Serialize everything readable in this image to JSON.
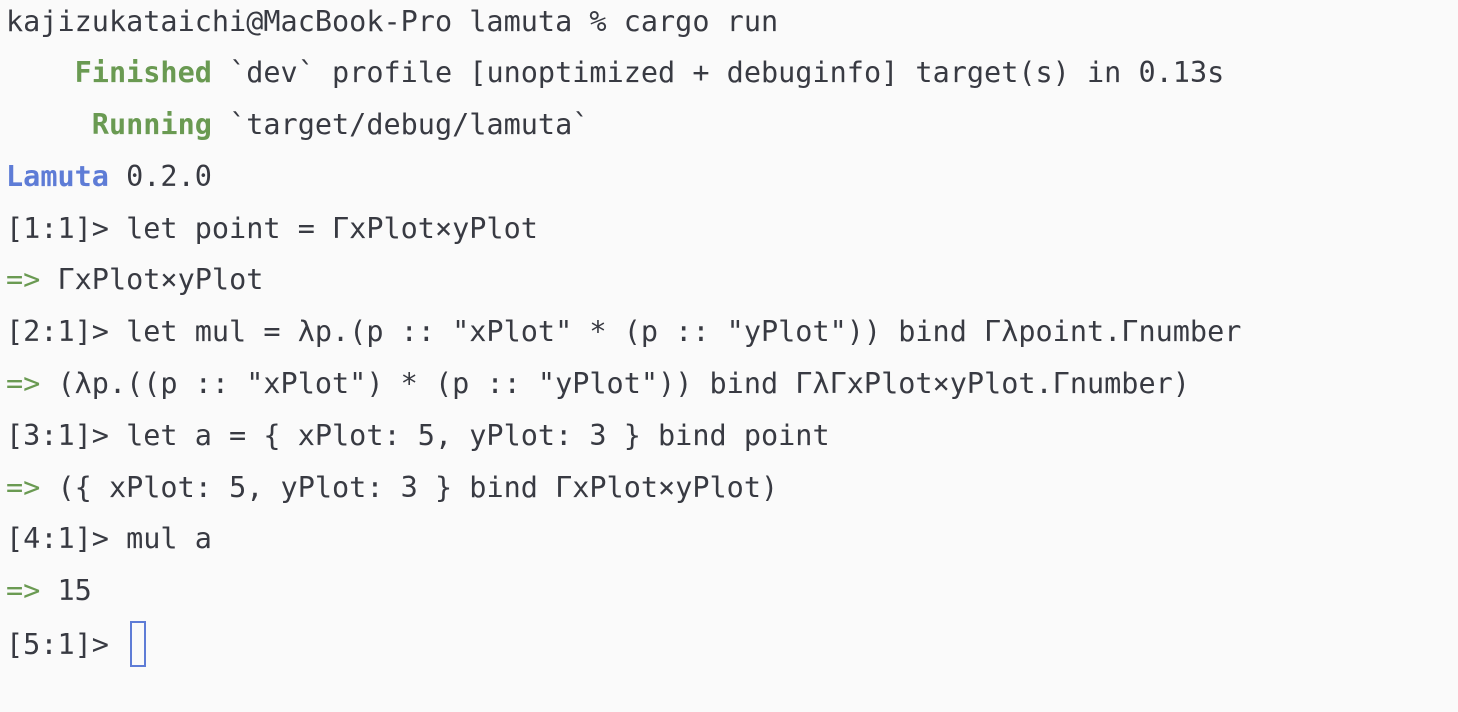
{
  "terminal": {
    "prompt_line": "kajizukataichi@MacBook-Pro lamuta % cargo run",
    "finished": {
      "indent": "    ",
      "label": "Finished",
      "text": " `dev` profile [unoptimized + debuginfo] target(s) in 0.13s"
    },
    "running": {
      "indent": "     ",
      "label": "Running",
      "text": " `target/debug/lamuta`"
    },
    "banner": {
      "name": "Lamuta",
      "version": " 0.2.0"
    },
    "entries": [
      {
        "prompt": "[1:1]> ",
        "input": "let point = ΓxPlot×yPlot",
        "arrow": "=>",
        "output": " ΓxPlot×yPlot"
      },
      {
        "prompt": "[2:1]> ",
        "input": "let mul = λp.(p :: \"xPlot\" * (p :: \"yPlot\")) bind Γλpoint.Γnumber",
        "arrow": "=>",
        "output": " (λp.((p :: \"xPlot\") * (p :: \"yPlot\")) bind ΓλΓxPlot×yPlot.Γnumber)"
      },
      {
        "prompt": "[3:1]> ",
        "input": "let a = { xPlot: 5, yPlot: 3 } bind point",
        "arrow": "=>",
        "output": " ({ xPlot: 5, yPlot: 3 } bind ΓxPlot×yPlot)"
      },
      {
        "prompt": "[4:1]> ",
        "input": "mul a",
        "arrow": "=>",
        "output": " 15"
      }
    ],
    "current_prompt": "[5:1]> ",
    "colors": {
      "background": "#fafafa",
      "text": "#383a42",
      "green": "#6a9a52",
      "blue": "#5e7cd6"
    }
  }
}
